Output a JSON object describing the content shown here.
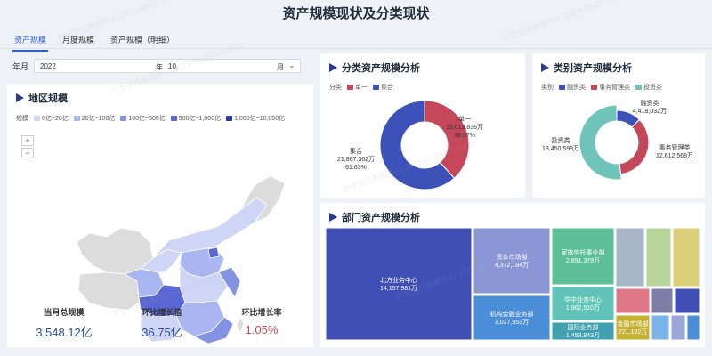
{
  "page": {
    "title": "资产规模现状及分类现状"
  },
  "tabs": [
    "资产规模",
    "月度规模",
    "资产规模（明细）"
  ],
  "filter": {
    "label": "年月",
    "year": "2022",
    "year_unit": "年",
    "month": "10",
    "month_unit": "月"
  },
  "map_card": {
    "title": "地区规模",
    "legend_title": "规模",
    "legend": [
      {
        "label": "0亿~20亿",
        "color": "#cfd6f5"
      },
      {
        "label": "20亿~100亿",
        "color": "#aab6ef"
      },
      {
        "label": "100亿~500亿",
        "color": "#8492e4"
      },
      {
        "label": "500亿~1,000亿",
        "color": "#5a66d2"
      },
      {
        "label": "1,000亿~10,000亿",
        "color": "#2f3aa8"
      }
    ],
    "zoom_in": "+",
    "zoom_out": "−"
  },
  "kpis": [
    {
      "label": "当月总规模",
      "value": "3,548.12亿"
    },
    {
      "label": "环比增长值",
      "value": "36.75亿"
    },
    {
      "label": "环比增长率",
      "value": "1.05%"
    }
  ],
  "category_card": {
    "title": "分类资产规模分析",
    "legend_title": "分类",
    "chart_data": {
      "type": "pie",
      "legend": [
        "单一",
        "集合"
      ],
      "slices": [
        {
          "name": "单一",
          "value": 13613836,
          "value_label": "13,613,836万",
          "percent": "38.37%",
          "color": "#c5475a"
        },
        {
          "name": "集合",
          "value": 21867362,
          "value_label": "21,867,362万",
          "percent": "61.63%",
          "color": "#3c52b8"
        }
      ]
    }
  },
  "type_card": {
    "title": "类别资产规模分析",
    "legend_title": "类别",
    "chart_data": {
      "type": "pie",
      "legend": [
        "融资类",
        "事务管理类",
        "投资类"
      ],
      "slices": [
        {
          "name": "融资类",
          "value": 4418032,
          "value_label": "4,418,032万",
          "color": "#3c52b8"
        },
        {
          "name": "事务管理类",
          "value": 12612568,
          "value_label": "12,612,568万",
          "color": "#c5475a"
        },
        {
          "name": "投资类",
          "value": 18450598,
          "value_label": "18,450,598万",
          "color": "#6fc3b8"
        }
      ]
    }
  },
  "dept_card": {
    "title": "部门资产规模分析",
    "chart_data": {
      "type": "treemap",
      "items": [
        {
          "name": "北方业务中心",
          "value_label": "14,157,981万",
          "value": 14157981,
          "color": "#3f4fb3"
        },
        {
          "name": "资本市场部",
          "value_label": "4,372,184万",
          "value": 4372184,
          "color": "#8a96d6"
        },
        {
          "name": "机构金融业务部",
          "value_label": "3,027,953万",
          "value": 3027953,
          "color": "#4a8ed8"
        },
        {
          "name": "家族信托事业部",
          "value_label": "2,851,379万",
          "value": 2851379,
          "color": "#5dbf9a"
        },
        {
          "name": "华中业务中心",
          "value_label": "1,962,510万",
          "value": 1962510,
          "color": "#62c3b8"
        },
        {
          "name": "国际业务部",
          "value_label": "1,453,843万",
          "value": 1453843,
          "color": "#3fa0b0"
        },
        {
          "name": "金融市场部",
          "value_label": "721,192万",
          "value": 721192,
          "color": "#c5b232"
        }
      ],
      "other_colors": [
        "#a8b6c8",
        "#b7d69a",
        "#dccf7a",
        "#e0788a",
        "#7c7ea8",
        "#3f4fb3",
        "#7ab4e8",
        "#9aa6d8",
        "#4a8ed8"
      ]
    }
  },
  "watermark": "华宝信托数据中心 2023-08-25 10:03:11"
}
